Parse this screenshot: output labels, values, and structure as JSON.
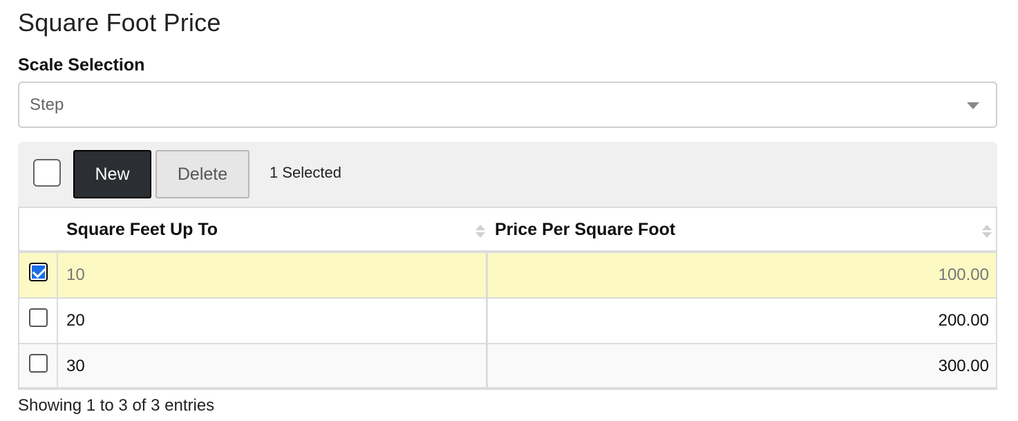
{
  "page": {
    "title": "Square Foot Price"
  },
  "scale_selection": {
    "label": "Scale Selection",
    "value": "Step"
  },
  "toolbar": {
    "new_label": "New",
    "delete_label": "Delete",
    "selected_text": "1 Selected"
  },
  "table": {
    "columns": [
      "Square Feet Up To",
      "Price Per Square Foot"
    ],
    "rows": [
      {
        "sqft": "10",
        "price": "100.00",
        "checked": true
      },
      {
        "sqft": "20",
        "price": "200.00",
        "checked": false
      },
      {
        "sqft": "30",
        "price": "300.00",
        "checked": false
      }
    ]
  },
  "footer": {
    "info": "Showing 1 to 3 of 3 entries"
  },
  "colors": {
    "selected_row": "#fcf9c4",
    "new_button": "#2b2f33",
    "checkbox_checked": "#1a6ee8"
  }
}
